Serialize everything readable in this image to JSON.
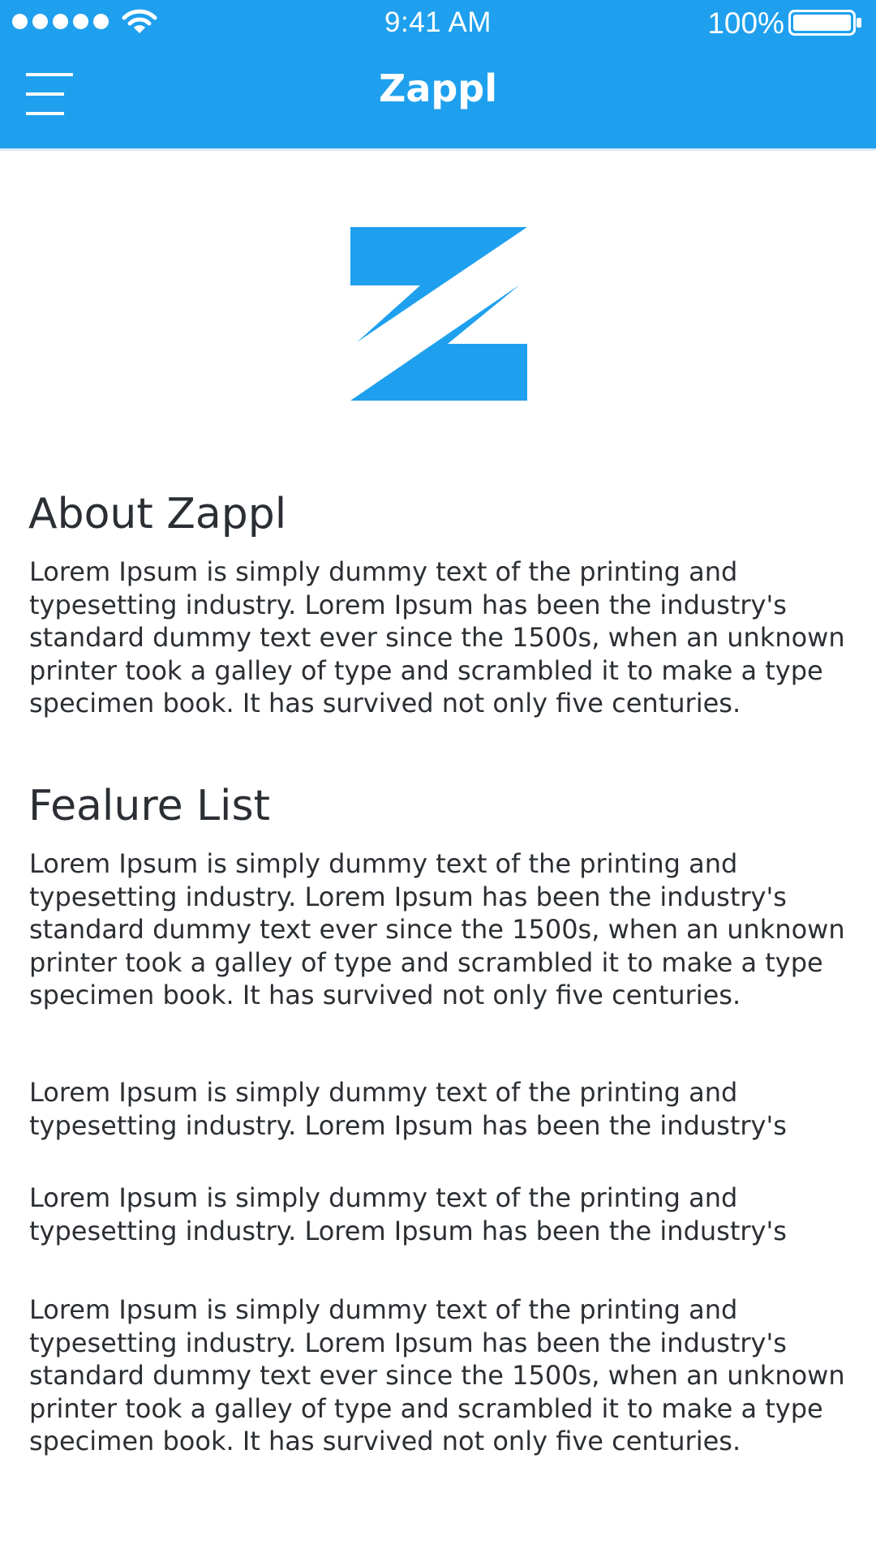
{
  "status_bar": {
    "time": "9:41 AM",
    "battery_percent": "100%",
    "signal_bars": 5,
    "icons": [
      "signal-dots-icon",
      "wifi-icon",
      "battery-icon"
    ]
  },
  "header": {
    "title": "Zappl",
    "menu_icon": "hamburger-menu-icon",
    "background_color": "#1fa0ee"
  },
  "logo": {
    "icon": "zappl-z-logo-icon",
    "color": "#1fa0ee"
  },
  "about": {
    "heading": "About Zappl",
    "text": "Lorem Ipsum is simply dummy text of the printing and typesetting industry. Lorem Ipsum has been the industry's standard dummy text ever since the 1500s, when an unknown printer took a galley of type and scrambled it to make a type specimen book. It has survived not only five centuries."
  },
  "features": {
    "heading": "Fealure List",
    "items": [
      "Lorem Ipsum is simply dummy text of the printing and typesetting industry. Lorem Ipsum has been the industry's standard dummy text ever since the 1500s, when an unknown printer took a galley of type and scrambled it to make a type specimen book. It has survived not only five centuries.",
      "Lorem Ipsum is simply dummy text of the printing and typesetting industry. Lorem Ipsum has been the industry's",
      "Lorem Ipsum is simply dummy text of the printing and typesetting industry. Lorem Ipsum has been the industry's",
      "Lorem Ipsum is simply dummy text of the printing and typesetting industry. Lorem Ipsum has been the industry's standard dummy text ever since the 1500s, when an unknown printer took a galley of type and scrambled it to make a type specimen book. It has survived not only five centuries."
    ]
  }
}
